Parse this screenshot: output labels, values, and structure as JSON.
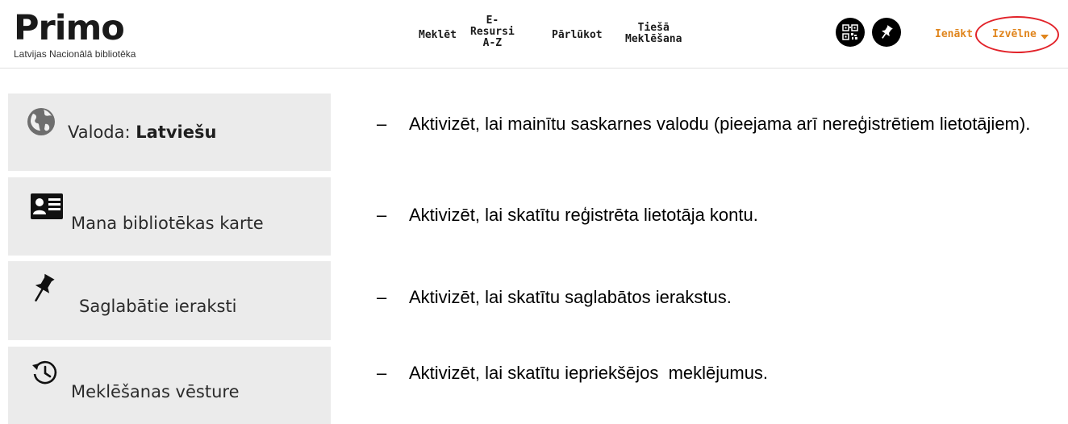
{
  "header": {
    "logo": {
      "title": "Primo",
      "subtitle": "Latvijas Nacionālā bibliotēka"
    },
    "nav": {
      "search": "Meklēt",
      "eresources": [
        "E-",
        "Resursi",
        "A-Z"
      ],
      "browse": "Pārlūkot",
      "direct_search": [
        "Tiešā",
        "Meklēšana"
      ]
    },
    "icons": [
      "qr-code-icon",
      "pin-icon"
    ],
    "login_label": "Ienākt",
    "menu_label": "Izvēlne",
    "accent_color": "#e0851d",
    "highlight_color": "#e2232a"
  },
  "menu_items": [
    {
      "icon": "globe-icon",
      "label_prefix": "Valoda: ",
      "label_bold": "Latviešu",
      "description": "Aktivizēt, lai mainītu saskarnes valodu (pieejama arī nereģistrētiem lietotājiem)."
    },
    {
      "icon": "id-card-icon",
      "label": "Mana bibliotēkas karte",
      "description": "Aktivizēt, lai skatītu reģistrēta lietotāja kontu."
    },
    {
      "icon": "pin-icon",
      "label": "Saglabātie ieraksti",
      "description": "Aktivizēt, lai skatītu saglabātos ierakstus."
    },
    {
      "icon": "history-icon",
      "label": "Meklēšanas vēsture",
      "description": "Aktivizēt, lai skatītu iepriekšējos  meklējumus."
    }
  ],
  "dash": "–"
}
